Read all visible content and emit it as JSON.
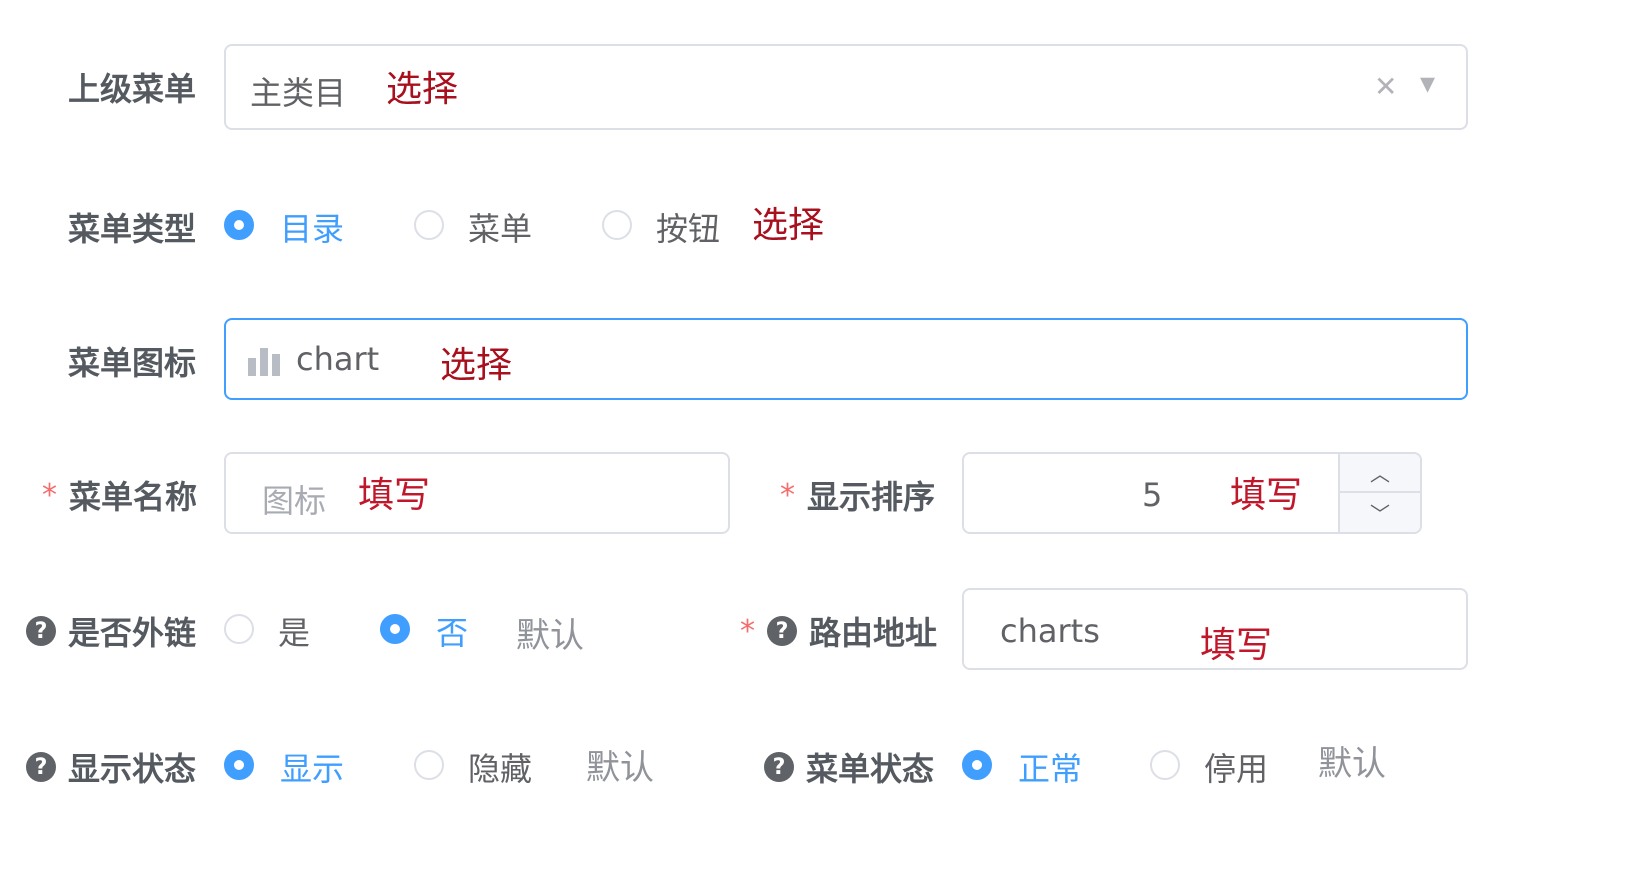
{
  "form": {
    "parent_menu": {
      "label": "上级菜单",
      "value": "主类目",
      "annotation": "选择",
      "clear_glyph": "✕",
      "dropdown_glyph": "▾"
    },
    "menu_type": {
      "label": "菜单类型",
      "options": [
        "目录",
        "菜单",
        "按钮"
      ],
      "selected": "目录",
      "annotation": "选择"
    },
    "menu_icon": {
      "label": "菜单图标",
      "value": "chart",
      "icon": "bar-chart-icon",
      "annotation": "选择"
    },
    "menu_name": {
      "required_mark": "*",
      "label": "菜单名称",
      "value": "图标",
      "annotation": "填写"
    },
    "display_order": {
      "required_mark": "*",
      "label": "显示排序",
      "value": "5",
      "annotation": "填写",
      "up_glyph": "︿",
      "down_glyph": "﹀"
    },
    "is_external": {
      "help_glyph": "?",
      "label": "是否外链",
      "options": [
        "是",
        "否"
      ],
      "selected": "否",
      "hint": "默认"
    },
    "route_path": {
      "required_mark": "*",
      "help_glyph": "?",
      "label": "路由地址",
      "value": "charts",
      "annotation": "填写"
    },
    "visible_status": {
      "help_glyph": "?",
      "label": "显示状态",
      "options": [
        "显示",
        "隐藏"
      ],
      "selected": "显示",
      "hint": "默认"
    },
    "menu_status": {
      "help_glyph": "?",
      "label": "菜单状态",
      "options": [
        "正常",
        "停用"
      ],
      "selected": "正常",
      "hint": "默认"
    }
  },
  "colors": {
    "accent": "#409eff",
    "annotation": "#c0172b",
    "required": "#f56c6c",
    "border": "#dcdfe6"
  }
}
